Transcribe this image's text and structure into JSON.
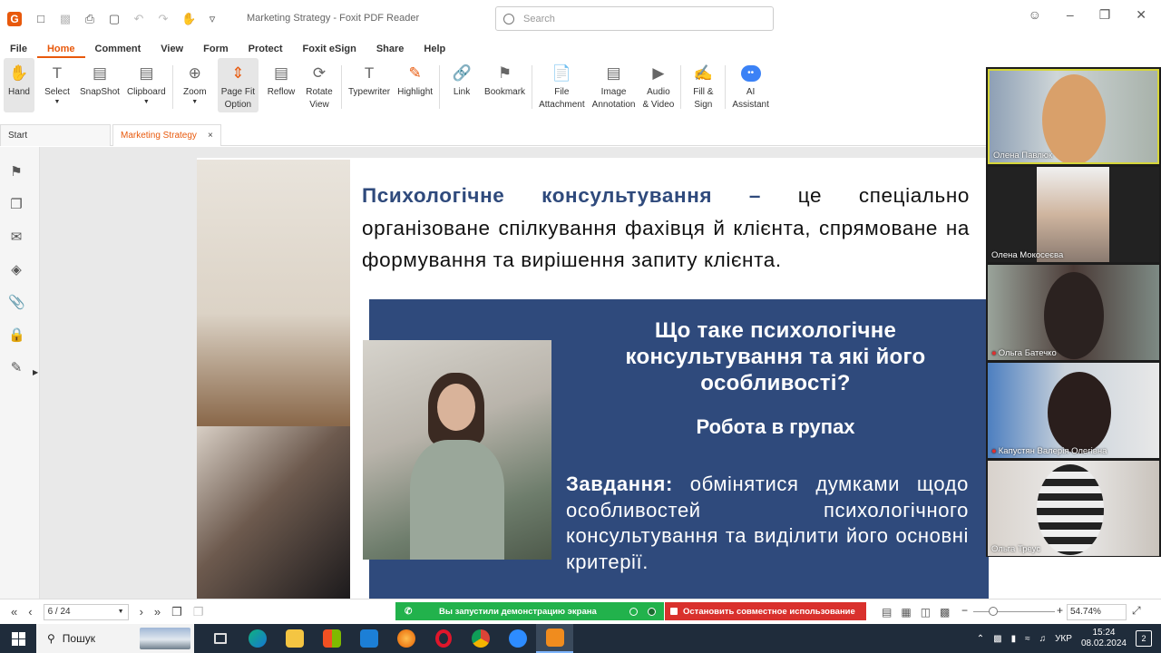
{
  "window": {
    "title": "Marketing Strategy - Foxit PDF Reader",
    "search_placeholder": "Search"
  },
  "menu": [
    "File",
    "Home",
    "Comment",
    "View",
    "Form",
    "Protect",
    "Foxit eSign",
    "Share",
    "Help"
  ],
  "ribbon": {
    "hand": "Hand",
    "select": "Select",
    "snapshot": "SnapShot",
    "clipboard": "Clipboard",
    "zoom": "Zoom",
    "page_fit_1": "Page Fit",
    "page_fit_2": "Option",
    "reflow": "Reflow",
    "rotate_1": "Rotate",
    "rotate_2": "View",
    "typewriter": "Typewriter",
    "highlight": "Highlight",
    "link": "Link",
    "bookmark": "Bookmark",
    "file_att_1": "File",
    "file_att_2": "Attachment",
    "image_ann_1": "Image",
    "image_ann_2": "Annotation",
    "audio_1": "Audio",
    "audio_2": "& Video",
    "fill_1": "Fill &",
    "fill_2": "Sign",
    "ai_1": "AI",
    "ai_2": "Assistant"
  },
  "tabs": {
    "start": "Start",
    "doc": "Marketing Strategy",
    "close": "×"
  },
  "slide": {
    "intro_term": "Психологічне консультування –",
    "intro_rest": " це спеціально організоване спілкування фахівця й клієнта, спрямоване на формування та вирішення запиту клієнта.",
    "question": "Що таке  психологічне консультування та які його особливості?",
    "subtitle": "Робота в групах",
    "task_label": "Завдання:",
    "task_text": " обмінятися думками щодо особливостей психологічного консультування  та виділити його основні критерії."
  },
  "participants": [
    {
      "name": "Олена Павлюк",
      "muted": false
    },
    {
      "name": "Олена Мокосеєва",
      "muted": false
    },
    {
      "name": "Ольга Батечко",
      "muted": true
    },
    {
      "name": "Капустян Валерія Олегівна",
      "muted": true
    },
    {
      "name": "Ольга Треус",
      "muted": false
    }
  ],
  "status": {
    "page": "6 / 24",
    "share_msg": "Вы запустили демонстрацию экрана",
    "stop_msg": "Остановить совместное использование",
    "zoom": "54.74%"
  },
  "taskbar": {
    "search": "Пошук",
    "lang": "УКР",
    "time": "15:24",
    "date": "08.02.2024",
    "notif_count": "2"
  }
}
